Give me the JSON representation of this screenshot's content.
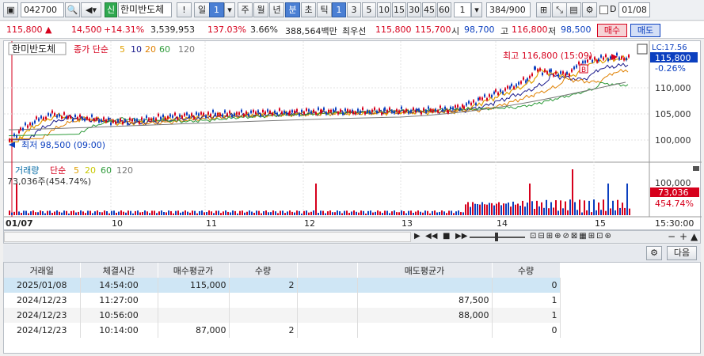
{
  "toolbar": {
    "code": "042700",
    "stock_tag": "신",
    "stock_name": "한미반도체",
    "period_buttons": [
      "일",
      "1",
      "주",
      "월",
      "년",
      "분",
      "초",
      "틱"
    ],
    "minute_buttons": [
      "1",
      "3",
      "5",
      "10",
      "15",
      "30",
      "45",
      "60"
    ],
    "interval_value": "1",
    "count_value": "384",
    "count_total": "/900",
    "date_value": "01/08",
    "checkbox_label": "D"
  },
  "quote": {
    "price": "115,800",
    "change": "14,500",
    "rate": "+14.31%",
    "volume": "3,539,953",
    "vol_ratio": "137.03%",
    "turnover": "3.66%",
    "amount": "388,564백만",
    "best_label": "최우선",
    "best_ask": "115,800",
    "best_bid": "115,700",
    "open_label": "시",
    "open": "98,700",
    "high_label": "고",
    "high": "116,800",
    "low_label": "저",
    "low": "98,500",
    "buy_label": "매수",
    "sell_label": "매도"
  },
  "chart": {
    "title": "한미반도체",
    "ma_label": "종가 단순",
    "ma_periods": [
      "5",
      "10",
      "20",
      "60",
      "120"
    ],
    "ma_colors": [
      "#e0a000",
      "#c8c800",
      "#e08000",
      "#2e9b3a",
      "#777777"
    ],
    "price_ticks": [
      "110,000",
      "105,000",
      "100,000"
    ],
    "high_annot": "최고 116,800 (15:09)",
    "low_annot": "최저 98,500 (09:00)",
    "lc_label": "LC:17.56",
    "current_price_tag": "115,800",
    "change_tag": "-0.26%",
    "volume_title": "거래량",
    "volume_ma_label": "단순",
    "volume_ma_periods": [
      "5",
      "20",
      "60",
      "120"
    ],
    "volume_value": "73,036주(454.74%)",
    "volume_ticks": [
      "100,000"
    ],
    "volume_tag": "73,036",
    "volume_pct_tag": "454.74%",
    "date_axis": [
      "01/07",
      "10",
      "11",
      "12",
      "13",
      "14",
      "15"
    ],
    "time_label": "15:30:00",
    "b_marker": "B",
    "colors": {
      "up": "#d6001c",
      "down": "#0b3fbf",
      "tag_bg": "#d6001c"
    }
  },
  "panel": {
    "next_label": "다음"
  },
  "table": {
    "headers": [
      "거래일",
      "체결시간",
      "매수평균가",
      "수량",
      "",
      "매도평균가",
      "수량"
    ],
    "rows": [
      [
        "2025/01/08",
        "14:54:00",
        "115,000",
        "2",
        "",
        "",
        "0"
      ],
      [
        "2024/12/23",
        "11:27:00",
        "",
        "",
        "",
        "87,500",
        "1"
      ],
      [
        "2024/12/23",
        "10:56:00",
        "",
        "",
        "",
        "88,000",
        "1"
      ],
      [
        "2024/12/23",
        "10:14:00",
        "87,000",
        "2",
        "",
        "",
        "0"
      ]
    ]
  }
}
